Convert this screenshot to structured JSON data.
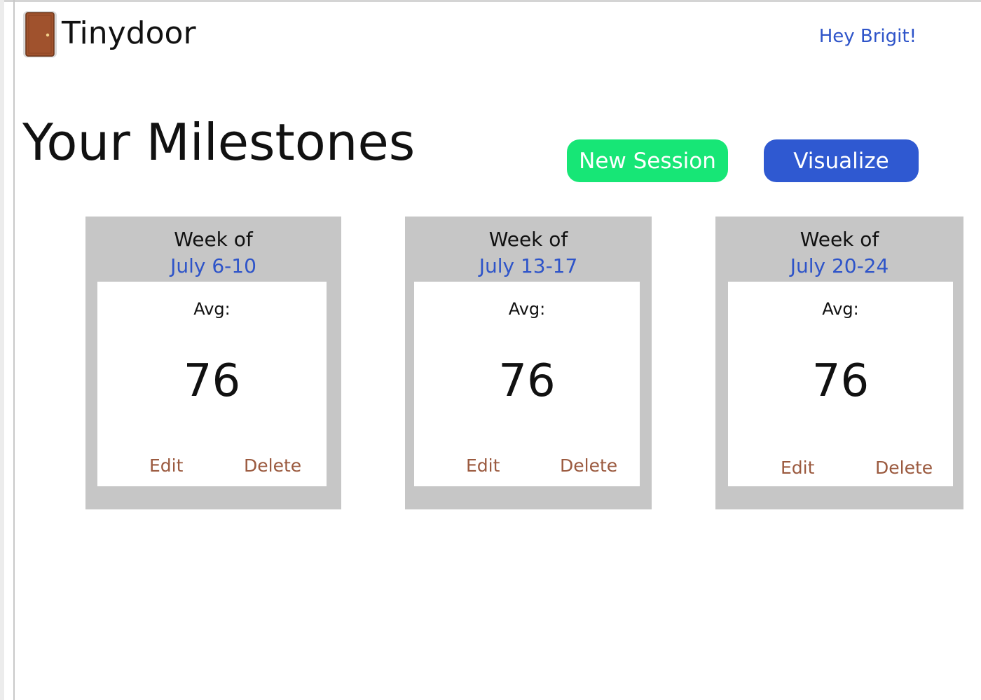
{
  "colors": {
    "accent_blue": "#2e54c9",
    "new_session_green": "#17e676",
    "visualize_blue": "#2f59d1",
    "action_brown": "#9b5a3f",
    "card_gray": "#c6c6c6",
    "door_brown": "#a0522d"
  },
  "header": {
    "logo_icon": "door-icon",
    "brand": "Tinydoor",
    "greeting": "Hey Brigit!"
  },
  "main": {
    "title": "Your Milestones",
    "new_session_label": "New Session",
    "visualize_label": "Visualize"
  },
  "cards": [
    {
      "week_label": "Week of",
      "dates": "July 6-10",
      "avg_label": "Avg:",
      "avg_value": "76",
      "edit_label": "Edit",
      "delete_label": "Delete"
    },
    {
      "week_label": "Week of",
      "dates": "July 13-17",
      "avg_label": "Avg:",
      "avg_value": "76",
      "edit_label": "Edit",
      "delete_label": "Delete"
    },
    {
      "week_label": "Week of",
      "dates": "July 20-24",
      "avg_label": "Avg:",
      "avg_value": "76",
      "edit_label": "Edit",
      "delete_label": "Delete"
    }
  ]
}
